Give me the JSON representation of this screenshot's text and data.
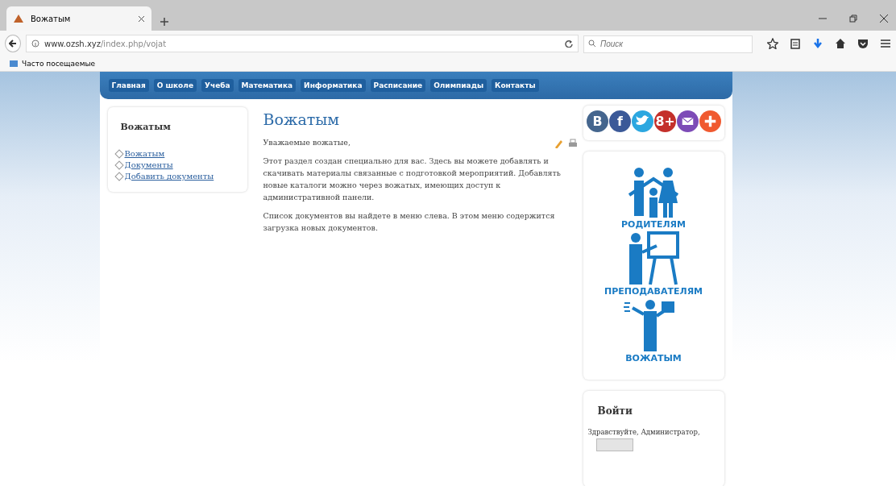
{
  "browser": {
    "tab_title": "Вожатым",
    "url_host": "www.ozsh.xyz",
    "url_path": "/index.php/vojat",
    "search_placeholder": "Поиск",
    "bookmark": "Часто посещаемые"
  },
  "nav": [
    "Главная",
    "О школе",
    "Учеба",
    "Математика",
    "Информатика",
    "Расписание",
    "Олимпиады",
    "Контакты"
  ],
  "sidebar": {
    "title": "Вожатым",
    "links": [
      "Вожатым",
      "Документы",
      "Добавить документы"
    ]
  },
  "article": {
    "title": "Вожатым",
    "paragraphs": [
      "Уважаемые вожатые,",
      "Этот раздел создан специально для вас. Здесь вы можете добавлять и скачивать материалы связанные с подготовкой мероприятий. Добавлять новые каталоги можно через вожатых, имеющих доступ к административной панели.",
      "Список документов вы найдете в меню слева. В этом меню содержится загрузка новых документов."
    ]
  },
  "social": [
    {
      "kind": "glyph",
      "glyph": "B",
      "color": "#45668e"
    },
    {
      "kind": "glyph",
      "glyph": "f",
      "color": "#3b5998"
    },
    {
      "kind": "bird",
      "color": "#2ca7e0"
    },
    {
      "kind": "glyph",
      "glyph": "8+",
      "color": "#c4302b"
    },
    {
      "kind": "mail",
      "color": "#7d4bb7"
    },
    {
      "kind": "plus",
      "color": "#f05a30"
    }
  ],
  "banners": [
    {
      "kind": "family",
      "caption": "РОДИТЕЛЯМ"
    },
    {
      "kind": "teacher",
      "caption": "ПРЕПОДАВАТЕЛЯМ"
    },
    {
      "kind": "leader",
      "caption": "ВОЖАТЫМ"
    }
  ],
  "login": {
    "title": "Войти",
    "greeting": "Здравствуйте, Администратор,"
  }
}
